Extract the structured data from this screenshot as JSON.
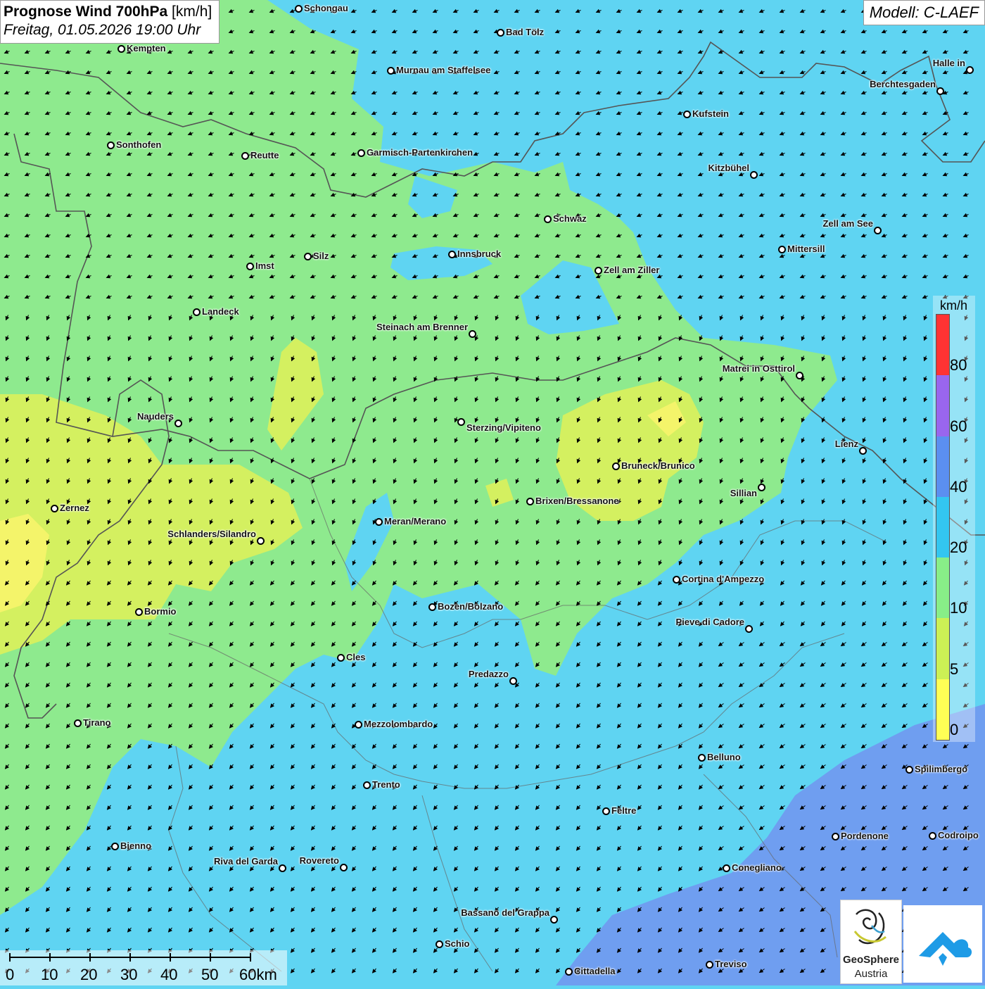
{
  "header": {
    "title_bold": "Prognose Wind 700hPa",
    "title_unit": "[km/h]",
    "subtitle": "Freitag, 01.05.2026 19:00 Uhr",
    "model": "Modell: C-LAEF"
  },
  "legend": {
    "unit": "km/h",
    "levels": [
      {
        "label": "0",
        "color": "#ffff55"
      },
      {
        "label": "5",
        "color": "#ccf055"
      },
      {
        "label": "10",
        "color": "#88ee88"
      },
      {
        "label": "20",
        "color": "#33c6f0"
      },
      {
        "label": "40",
        "color": "#5b8ff0"
      },
      {
        "label": "60",
        "color": "#9966ee"
      },
      {
        "label": "80",
        "color": "#ff3333"
      }
    ]
  },
  "scale": {
    "labels": [
      "0",
      "10",
      "20",
      "30",
      "40",
      "50",
      "60km"
    ]
  },
  "logos": {
    "geosphere_line1": "GeoSphere",
    "geosphere_line2": "Austria"
  },
  "colors": {
    "wind_lt5": "#ffff55",
    "wind_5_10": "#ccf055",
    "wind_10_20": "#88ee88",
    "wind_20_40": "#5fd4f2",
    "wind_40_60": "#6f9ef0"
  },
  "cities": [
    "Schongau",
    "Bad Tölz",
    "Kempten",
    "Murnau am Staffelsee",
    "Halle in",
    "Berchtesgaden",
    "Kufstein",
    "Sonthofen",
    "Reutte",
    "Garmisch-Partenkirchen",
    "Kitzbühel",
    "Schwaz",
    "Zell am See",
    "Mittersill",
    "Imst",
    "Silz",
    "Innsbruck",
    "Zell am Ziller",
    "Landeck",
    "Steinach am Brenner",
    "Matrei in Osttirol",
    "Nauders",
    "Sterzing/Vipiteno",
    "Lienz",
    "Bruneck/Brunico",
    "Sillian",
    "Zernez",
    "Brixen/Bressanone",
    "Meran/Merano",
    "Schlanders/Silandro",
    "Cortina d'Ampezzo",
    "Bozen/Bolzano",
    "Bormio",
    "Pieve di Cadore",
    "Cles",
    "Predazzo",
    "Tirano",
    "Mezzolombardo",
    "Belluno",
    "Spilimbergo",
    "Trento",
    "Feltre",
    "Bienno",
    "Pordenone",
    "Codroipo",
    "Riva del Garda",
    "Rovereto",
    "Conegliano",
    "Bassano del Grappa",
    "Schio",
    "Treviso",
    "Cittadella"
  ]
}
